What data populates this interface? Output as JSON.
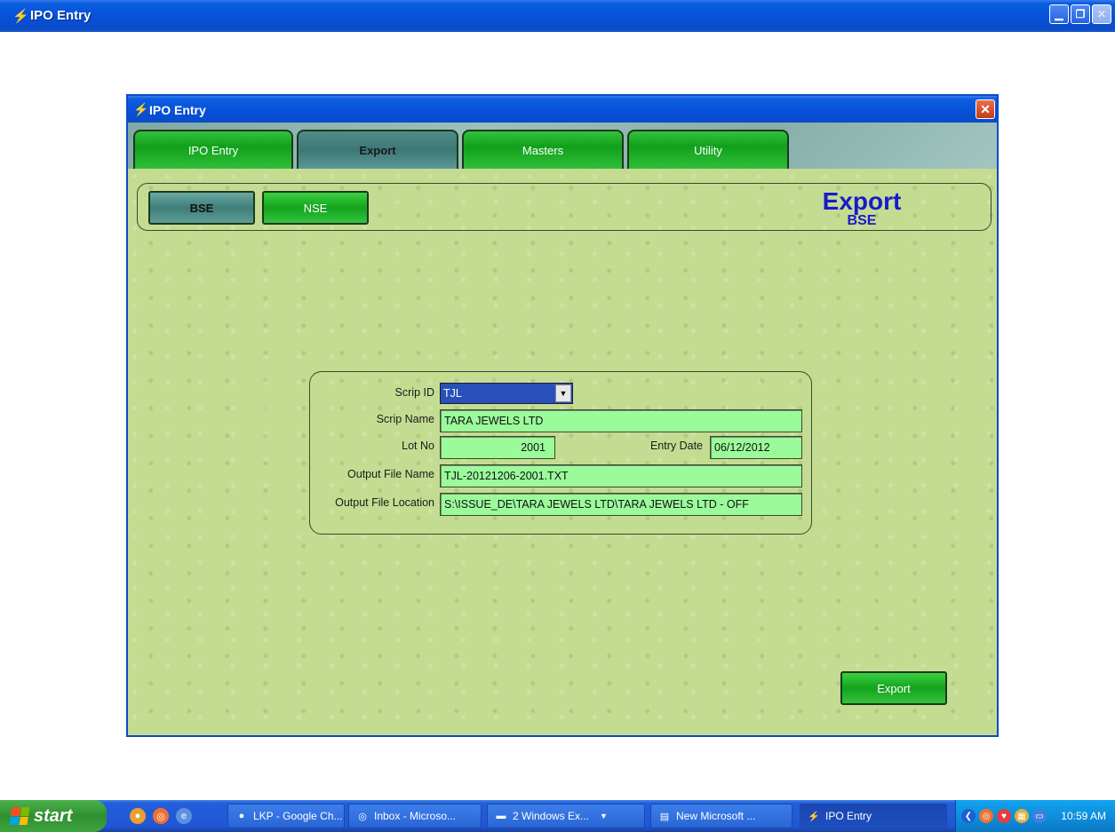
{
  "window": {
    "title": "IPO Entry",
    "minimize_glyph": "▁",
    "restore_glyph": "❐",
    "close_glyph": "✕"
  },
  "dialog": {
    "title": "IPO Entry",
    "close_glyph": "✕"
  },
  "tabs": [
    {
      "label": "IPO Entry",
      "active": false
    },
    {
      "label": "Export",
      "active": true
    },
    {
      "label": "Masters",
      "active": false
    },
    {
      "label": "Utility",
      "active": false
    }
  ],
  "exchange": {
    "bse_label": "BSE",
    "nse_label": "NSE",
    "heading": "Export",
    "subheading": "BSE"
  },
  "form": {
    "scrip_id_label": "Scrip ID",
    "scrip_id_value": "TJL",
    "scrip_name_label": "Scrip Name",
    "scrip_name_value": "TARA JEWELS LTD",
    "lot_no_label": "Lot No",
    "lot_no_value": "2001",
    "entry_date_label": "Entry Date",
    "entry_date_value": "06/12/2012",
    "output_file_name_label": "Output File Name",
    "output_file_name_value": "TJL-20121206-2001.TXT",
    "output_file_location_label": "Output File Location",
    "output_file_location_value": "S:\\ISSUE_DE\\TARA JEWELS LTD\\TARA JEWELS LTD - OFF"
  },
  "actions": {
    "export_label": "Export"
  },
  "taskbar": {
    "start_label": "start",
    "tasks": [
      {
        "label": "LKP - Google Ch...",
        "icon": "chrome-icon"
      },
      {
        "label": "Inbox - Microso...",
        "icon": "outlook-icon"
      },
      {
        "label": "2 Windows Ex...",
        "icon": "folder-icon"
      },
      {
        "label": "New Microsoft ...",
        "icon": "word-icon"
      },
      {
        "label": "IPO Entry",
        "icon": "ipo-app-icon"
      }
    ],
    "clock": "10:59 AM"
  },
  "colors": {
    "title_blue": "#0750d8",
    "field_green": "#9bfb9b",
    "tab_green": "#11a01b",
    "tab_active": "#3d7875",
    "heading_blue": "#1a1acc",
    "background_green": "#c4dc92"
  }
}
